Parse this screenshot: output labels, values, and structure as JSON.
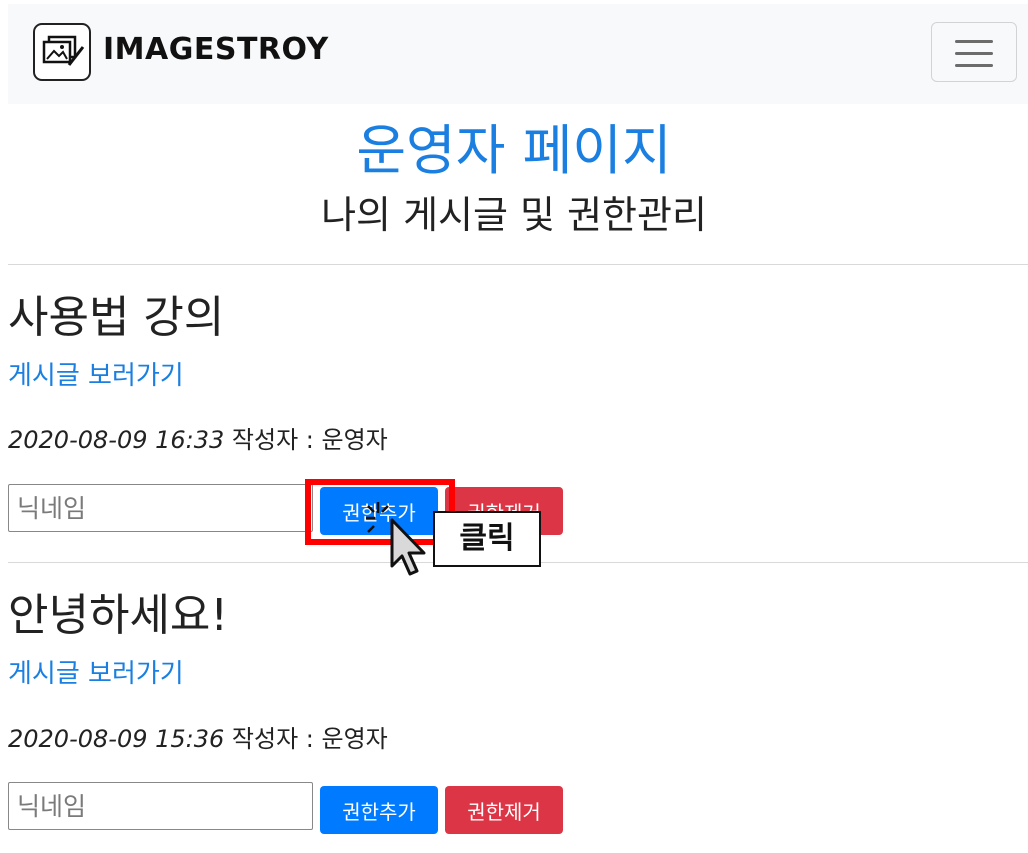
{
  "header": {
    "brand": "IMAGESTROY",
    "logo_icon": "image-edit-icon",
    "menu_icon": "hamburger-menu-icon"
  },
  "page": {
    "title": "운영자 페이지",
    "subtitle": "나의 게시글 및 권한관리"
  },
  "posts": [
    {
      "title": "사용법 강의",
      "link_label": "게시글 보러가기",
      "date": "2020-08-09 16:33",
      "author_label": "작성자 : 운영자",
      "nickname_placeholder": "닉네임",
      "nickname_value": "",
      "add_label": "권한추가",
      "remove_label": "권한제거"
    },
    {
      "title": "안녕하세요!",
      "link_label": "게시글 보러가기",
      "date": "2020-08-09 15:36",
      "author_label": "작성자 : 운영자",
      "nickname_placeholder": "닉네임",
      "nickname_value": "",
      "add_label": "권한추가",
      "remove_label": "권한제거"
    }
  ],
  "annotation": {
    "callout_text": "클릭",
    "highlight_color": "#ff0000"
  },
  "colors": {
    "primary": "#007bff",
    "danger": "#dc3545",
    "link": "#1a7fe0",
    "navbar_bg": "#f8f9fa"
  }
}
